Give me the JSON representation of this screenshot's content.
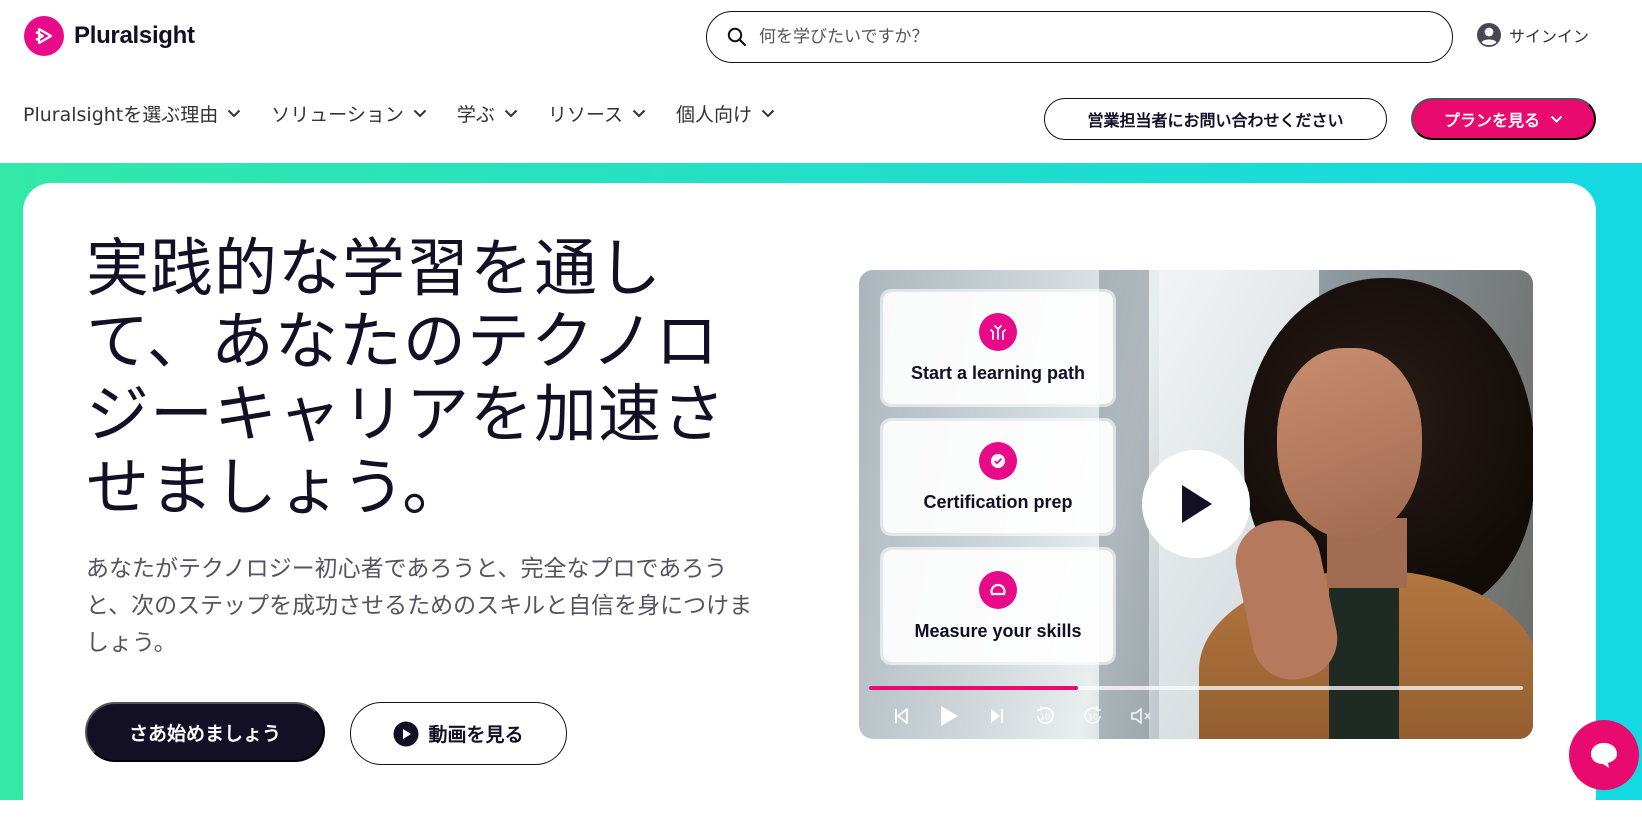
{
  "brand": {
    "name": "Pluralsight",
    "accent": "#e80a89"
  },
  "search": {
    "placeholder": "何を学びたいですか？"
  },
  "header": {
    "signin_label": "サインイン"
  },
  "nav": {
    "items": [
      {
        "label": "Pluralsightを選ぶ理由"
      },
      {
        "label": "ソリューション"
      },
      {
        "label": "学ぶ"
      },
      {
        "label": "リソース"
      },
      {
        "label": "個人向け"
      }
    ],
    "contact_label": "営業担当者にお問い合わせください",
    "plans_label": "プランを見る"
  },
  "hero": {
    "headline": "実践的な学習を通して、あなたのテクノロジーキャリアを加速させましょう。",
    "subtext": "あなたがテクノロジー初心者であろうと、完全なプロであろうと、次のステップを成功させるためのスキルと自信を身につけましょう。",
    "start_label": "さあ始めましょう",
    "watch_label": "動画を見る"
  },
  "video": {
    "tiles": [
      {
        "label": "Start a learning path",
        "icon": "learning-path-icon"
      },
      {
        "label": "Certification prep",
        "icon": "certification-badge-icon"
      },
      {
        "label": "Measure your skills",
        "icon": "skill-measure-icon"
      }
    ],
    "progress": 0.32,
    "progress_color": "#e80a6e"
  },
  "hero_gradient": [
    "#33e8a8",
    "#14d9e2"
  ]
}
